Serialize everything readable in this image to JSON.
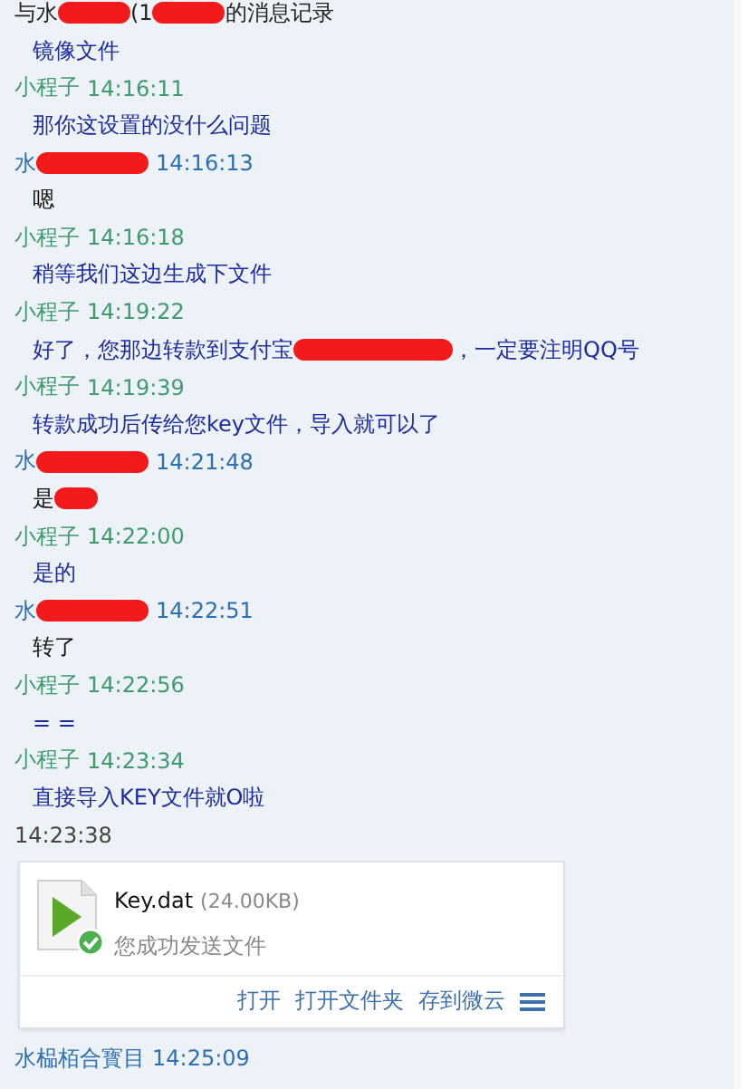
{
  "title_line": [
    {
      "kind": "text",
      "text": "与水"
    },
    {
      "kind": "redaction"
    },
    {
      "kind": "text",
      "text": "(1"
    },
    {
      "kind": "redaction"
    },
    {
      "kind": "text",
      "text": "的消息记录"
    }
  ],
  "entries": [
    {
      "kind": "self_message",
      "segments": [
        {
          "kind": "text",
          "text": "镜像文件"
        }
      ]
    },
    {
      "kind": "self_header",
      "segments": [
        {
          "kind": "text",
          "text": "小程子"
        }
      ],
      "time": "14:16:11"
    },
    {
      "kind": "self_message",
      "segments": [
        {
          "kind": "text",
          "text": "那你这设置的没什么问题"
        }
      ]
    },
    {
      "kind": "peer_header",
      "segments": [
        {
          "kind": "text",
          "text": "水"
        },
        {
          "kind": "redaction"
        }
      ],
      "time": "14:16:13"
    },
    {
      "kind": "peer_message",
      "segments": [
        {
          "kind": "text",
          "text": "嗯"
        }
      ]
    },
    {
      "kind": "self_header",
      "segments": [
        {
          "kind": "text",
          "text": "小程子"
        }
      ],
      "time": "14:16:18"
    },
    {
      "kind": "self_message",
      "segments": [
        {
          "kind": "text",
          "text": "稍等我们这边生成下文件"
        }
      ]
    },
    {
      "kind": "self_header",
      "segments": [
        {
          "kind": "text",
          "text": "小程子"
        }
      ],
      "time": "14:19:22"
    },
    {
      "kind": "self_message",
      "segments": [
        {
          "kind": "text",
          "text": "好了，您那边转款到支付宝"
        },
        {
          "kind": "redaction"
        },
        {
          "kind": "text",
          "text": "，一定要注明QQ号"
        }
      ]
    },
    {
      "kind": "self_header",
      "segments": [
        {
          "kind": "text",
          "text": "小程子"
        }
      ],
      "time": "14:19:39"
    },
    {
      "kind": "self_message",
      "segments": [
        {
          "kind": "text",
          "text": "转款成功后传给您key文件，导入就可以了"
        }
      ]
    },
    {
      "kind": "peer_header",
      "segments": [
        {
          "kind": "text",
          "text": "水"
        },
        {
          "kind": "redaction"
        }
      ],
      "time": "14:21:48"
    },
    {
      "kind": "peer_message",
      "segments": [
        {
          "kind": "text",
          "text": "是"
        },
        {
          "kind": "redaction"
        }
      ]
    },
    {
      "kind": "self_header",
      "segments": [
        {
          "kind": "text",
          "text": "小程子"
        }
      ],
      "time": "14:22:00"
    },
    {
      "kind": "self_message",
      "segments": [
        {
          "kind": "text",
          "text": "是的"
        }
      ]
    },
    {
      "kind": "peer_header",
      "segments": [
        {
          "kind": "text",
          "text": "水"
        },
        {
          "kind": "redaction"
        }
      ],
      "time": "14:22:51"
    },
    {
      "kind": "peer_message",
      "segments": [
        {
          "kind": "text",
          "text": "转了"
        }
      ]
    },
    {
      "kind": "self_header",
      "segments": [
        {
          "kind": "text",
          "text": "小程子"
        }
      ],
      "time": "14:22:56"
    },
    {
      "kind": "self_message",
      "segments": [
        {
          "kind": "text",
          "text": "= ="
        }
      ]
    },
    {
      "kind": "self_header",
      "segments": [
        {
          "kind": "text",
          "text": "小程子"
        }
      ],
      "time": "14:23:34"
    },
    {
      "kind": "self_message",
      "segments": [
        {
          "kind": "text",
          "text": "直接导入KEY文件就O啦"
        }
      ]
    },
    {
      "kind": "time_header",
      "time": "14:23:38"
    },
    {
      "kind": "file",
      "name": "Key.dat",
      "size": "(24.00KB)",
      "status": "您成功发送文件",
      "actions": [
        "打开",
        "打开文件夹",
        "存到微云"
      ]
    },
    {
      "kind": "peer_header",
      "segments": [
        {
          "kind": "text",
          "text": "水榀栢合寳目"
        }
      ],
      "time": "14:25:09"
    }
  ]
}
